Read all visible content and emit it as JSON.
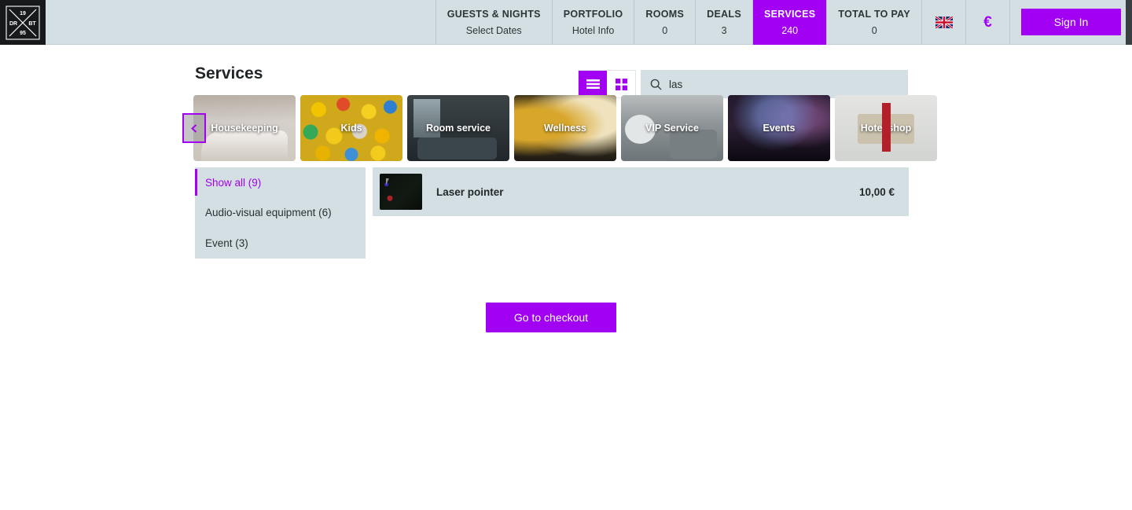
{
  "brand": {
    "name": "drbt-logo",
    "top_text": "19",
    "left_text": "DR",
    "right_text": "BT",
    "bottom_text": "95"
  },
  "header": {
    "nav_items": [
      {
        "label": "GUESTS & NIGHTS",
        "value": "Select Dates",
        "active": false,
        "wide": true
      },
      {
        "label": "PORTFOLIO",
        "value": "Hotel Info",
        "active": false,
        "wide": false
      },
      {
        "label": "ROOMS",
        "value": "0",
        "active": false,
        "wide": false
      },
      {
        "label": "DEALS",
        "value": "3",
        "active": false,
        "wide": false
      },
      {
        "label": "SERVICES",
        "value": "240",
        "active": true,
        "wide": false
      },
      {
        "label": "TOTAL TO PAY",
        "value": "0",
        "active": false,
        "wide": false
      }
    ],
    "language_icon": "uk-flag-icon",
    "currency_symbol": "€",
    "sign_in_label": "Sign In"
  },
  "page": {
    "title": "Services"
  },
  "view_toggle": {
    "list_icon": "list-view-icon",
    "grid_icon": "grid-view-icon",
    "active": "list"
  },
  "search": {
    "icon": "search-icon",
    "value": "las",
    "placeholder": ""
  },
  "carousel": {
    "scroll_left_icon": "chevron-left-icon",
    "tiles": [
      {
        "label": "Housekeeping",
        "art": "art-housekeeping",
        "selected": false
      },
      {
        "label": "Kids",
        "art": "art-kids",
        "selected": false
      },
      {
        "label": "Room service",
        "art": "art-roomservice",
        "selected": false
      },
      {
        "label": "Wellness",
        "art": "art-wellness",
        "selected": false
      },
      {
        "label": "VIP Service",
        "art": "art-vip",
        "selected": false
      },
      {
        "label": "Events",
        "art": "art-events",
        "selected": true
      },
      {
        "label": "Hotel shop",
        "art": "art-hotelshop",
        "selected": false
      }
    ]
  },
  "filters": [
    {
      "label": "Show all (9)",
      "active": true
    },
    {
      "label": "Audio-visual equipment (6)",
      "active": false
    },
    {
      "label": "Event (3)",
      "active": false
    }
  ],
  "results": [
    {
      "name": "Laser pointer",
      "price": "10,00 €"
    }
  ],
  "checkout": {
    "label": "Go to checkout"
  },
  "colors": {
    "accent": "#a100f2",
    "header_bg": "#d3dfe3",
    "panel_bg": "#d3dfe3",
    "text": "#2a3033",
    "brand_bg": "#17191a"
  }
}
